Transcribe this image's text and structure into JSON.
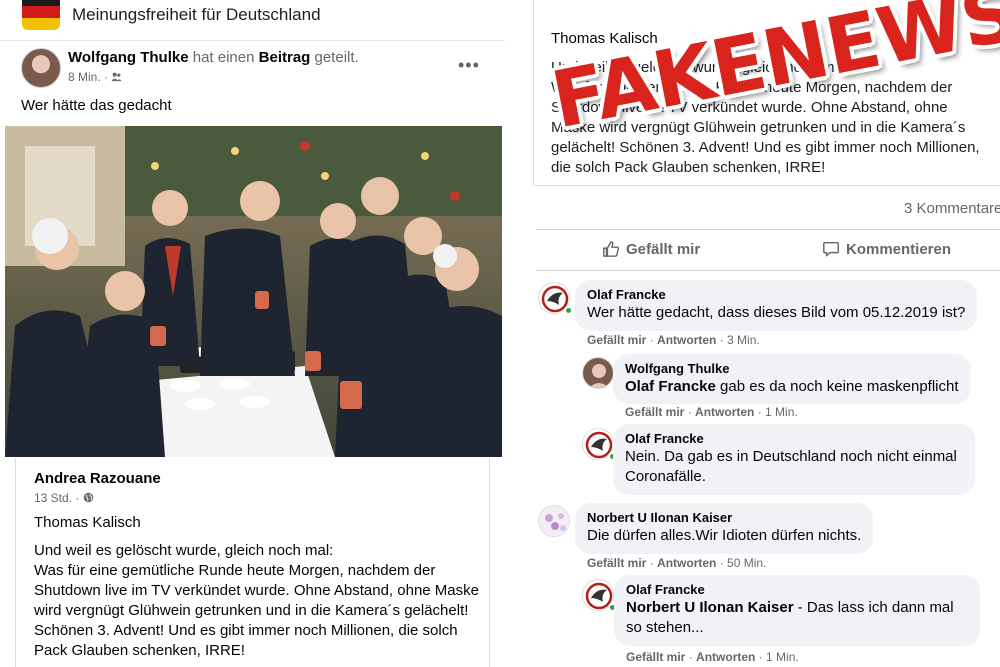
{
  "group": {
    "name": "Meinungsfreiheit für Deutschland"
  },
  "post": {
    "author": "Wolfgang Thulke",
    "action_prefix": "hat einen",
    "action_object": "Beitrag",
    "action_suffix": "geteilt.",
    "time": "8 Min. · ",
    "audience_icon": "group-icon",
    "text": "Wer hätte das gedacht"
  },
  "shared": {
    "author": "Andrea Razouane",
    "time": "13 Std. · ",
    "audience_icon": "globe-icon",
    "tagged_name": "Thomas Kalisch",
    "body": "Und weil es gelöscht wurde, gleich noch mal:\nWas  für eine gemütliche Runde heute Morgen, nachdem der Shutdown live im TV  verkündet wurde. Ohne Abstand, ohne Maske wird vergnügt Glühwein  getrunken und in die Kamera´s gelächelt! Schönen 3. Advent! Und es gibt  immer noch Millionen, die solch Pack Glauben schenken, IRRE!"
  },
  "right": {
    "tagged_name": "Thomas Kalisch",
    "body": "Und weil es gelöscht wurde, gleich noch mal:\nWas  für eine gemütliche Runde heute Morgen, nachdem der Shutdown live im TV  verkündet wurde. Ohne Abstand, ohne Maske wird vergnügt Glühwein  getrunken und in die Kamera´s gelächelt! Schönen 3. Advent! Und es gibt  immer noch Millionen, die solch Pack Glauben schenken, IRRE!",
    "comment_count": "3 Kommentare",
    "like_label": "Gefällt mir",
    "comment_label": "Kommentieren"
  },
  "comments": [
    {
      "name": "Olaf Francke",
      "text": "Wer hätte gedacht, dass dieses Bild vom 05.12.2019 ist?",
      "like": "Gefällt mir",
      "reply": "Antworten",
      "time": "3 Min."
    },
    {
      "name": "Wolfgang Thulke",
      "mention": "Olaf Francke",
      "text": " gab es da noch keine maskenpflicht",
      "like": "Gefällt mir",
      "reply": "Antworten",
      "time": "1 Min."
    },
    {
      "name": "Olaf Francke",
      "text": "Nein. Da gab es in Deutschland noch nicht einmal Coronafälle.",
      "like": "",
      "reply": "",
      "time": ""
    },
    {
      "name": "Norbert U Ilonan Kaiser",
      "text": "Die dürfen alles.Wir Idioten dürfen nichts.",
      "like": "Gefällt mir",
      "reply": "Antworten",
      "time": "50 Min."
    },
    {
      "name": "Olaf Francke",
      "mention": "Norbert U Ilonan Kaiser",
      "text": " - Das lass ich dann mal so stehen...",
      "like": "Gefällt mir",
      "reply": "Antworten",
      "time": "1 Min."
    }
  ],
  "stamp": {
    "text": "FAKENEWS!",
    "color": "#d8241c"
  },
  "icons": {
    "more": "more-dots-icon",
    "like": "thumbs-up-icon",
    "comment": "comment-bubble-icon"
  }
}
